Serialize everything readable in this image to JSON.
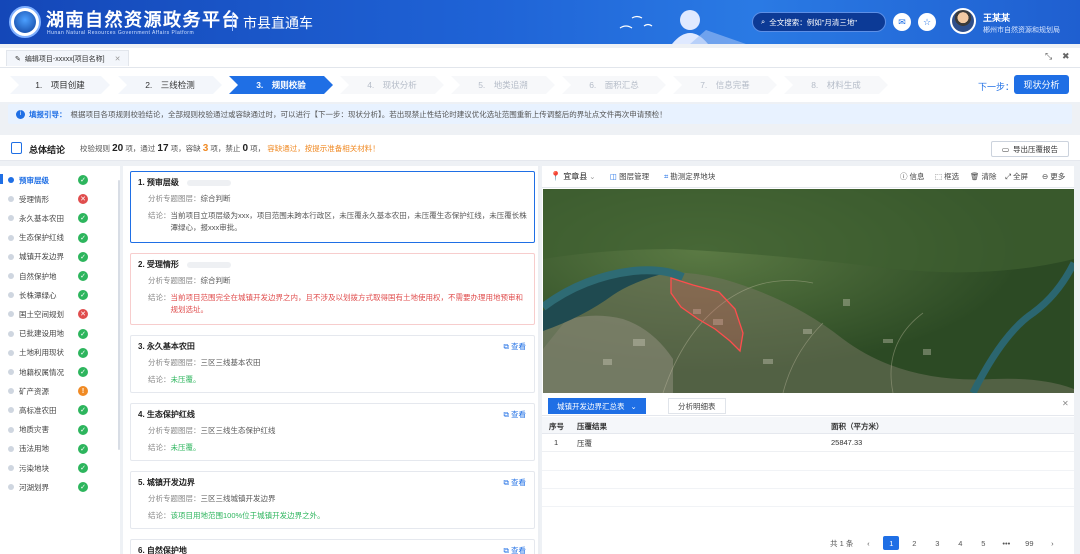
{
  "header": {
    "title": "湖南自然资源政务平台",
    "subtitle": "Hunan Natural Resources Government Affairs Platform",
    "system": "市县直通车",
    "search_placeholder": "全文搜索：例如\"月清三地\"",
    "user_name": "王某某",
    "user_dept": "郴州市自然资源和规划局"
  },
  "tabs": [
    {
      "label": "编辑项目-xxxxx[项目名称]"
    }
  ],
  "steps": [
    {
      "label": "1.　项目创建",
      "state": "done"
    },
    {
      "label": "2.　三线检测",
      "state": "done"
    },
    {
      "label": "3.　规则校验",
      "state": "active"
    },
    {
      "label": "4.　现状分析",
      "state": "todo"
    },
    {
      "label": "5.　地类追溯",
      "state": "todo"
    },
    {
      "label": "6.　面积汇总",
      "state": "todo"
    },
    {
      "label": "7.　信息完善",
      "state": "todo"
    },
    {
      "label": "8.　材料生成",
      "state": "todo"
    }
  ],
  "next": {
    "label": "下一步：",
    "button": "现状分析"
  },
  "guide": {
    "prefix": "填报引导：",
    "text": "根据项目各项规则校验结论，全部规则校验通过或容缺通过时，可以进行【下一步：现状分析】。若出现禁止性结论时建议优化选址范围重新上传调整后的界址点文件再次申请预检！"
  },
  "summary": {
    "title": "总体结论",
    "rules_label": "校验规则",
    "rules_count": "20",
    "pass_label": "项，通过",
    "pass_count": "17",
    "tol_label": "项，容缺",
    "tol_count": "3",
    "forbid_label": "项，禁止",
    "forbid_count": "0",
    "end_label": "项，",
    "notice": "容缺通过，按提示准备相关材料！",
    "export": "导出压覆报告"
  },
  "sidebar": [
    {
      "label": "预审层级",
      "status": "ok",
      "selected": true
    },
    {
      "label": "受理情形",
      "status": "err"
    },
    {
      "label": "永久基本农田",
      "status": "ok"
    },
    {
      "label": "生态保护红线",
      "status": "ok"
    },
    {
      "label": "城镇开发边界",
      "status": "ok"
    },
    {
      "label": "自然保护地",
      "status": "ok"
    },
    {
      "label": "长株潭绿心",
      "status": "ok"
    },
    {
      "label": "国土空间规划",
      "status": "err"
    },
    {
      "label": "已批建设用地",
      "status": "ok"
    },
    {
      "label": "土地利用现状",
      "status": "ok"
    },
    {
      "label": "地籍权属情况",
      "status": "ok"
    },
    {
      "label": "矿产资源",
      "status": "warn"
    },
    {
      "label": "高标准农田",
      "status": "ok"
    },
    {
      "label": "地质灾害",
      "status": "ok"
    },
    {
      "label": "违法用地",
      "status": "ok"
    },
    {
      "label": "污染地块",
      "status": "ok"
    },
    {
      "label": "河湖划界",
      "status": "ok"
    }
  ],
  "cards": [
    {
      "title": "1. 预审层级",
      "layer_label": "分析专题图层：",
      "layer": "综合判断",
      "result_label": "结论：",
      "result": "当前项目立项层级为xxx，项目范围未跨本行政区，未压覆永久基本农田，未压覆生态保护红线，未压覆长株潭绿心，报xxx审批。",
      "tone": "normal",
      "view": ""
    },
    {
      "title": "2. 受理情形",
      "layer_label": "分析专题图层：",
      "layer": "综合判断",
      "result_label": "结论：",
      "result": "当前项目范围完全在城镇开发边界之内，且不涉及以划拨方式取得国有土地使用权，不需要办理用地预审和规划选址。",
      "tone": "red",
      "view": ""
    },
    {
      "title": "3. 永久基本农田",
      "layer_label": "分析专题图层：",
      "layer": "三区三线基本农田",
      "result_label": "结论：",
      "result": "未压覆。",
      "tone": "green",
      "view": "查看"
    },
    {
      "title": "4. 生态保护红线",
      "layer_label": "分析专题图层：",
      "layer": "三区三线生态保护红线",
      "result_label": "结论：",
      "result": "未压覆。",
      "tone": "green",
      "view": "查看"
    },
    {
      "title": "5. 城镇开发边界",
      "layer_label": "分析专题图层：",
      "layer": "三区三线城镇开发边界",
      "result_label": "结论：",
      "result": "该项目用地范围100%位于城镇开发边界之外。",
      "tone": "green",
      "view": "查看"
    },
    {
      "title": "6. 自然保护地",
      "layer_label": "",
      "layer": "",
      "result_label": "",
      "result": "",
      "tone": "normal",
      "view": "查看"
    }
  ],
  "map_toolbar": {
    "county": "宜章县",
    "layer_mgmt": "图层管理",
    "draw_boundary": "勘测定界地块",
    "info": "信息",
    "select": "框选",
    "clear": "清除",
    "fullscreen": "全屏",
    "more": "更多"
  },
  "result_tabs": [
    {
      "label": "城镇开发边界汇总表"
    },
    {
      "label": "分析明细表"
    }
  ],
  "table": {
    "headers": [
      "序号",
      "压覆结果",
      "面积（平方米）"
    ],
    "rows": [
      [
        "1",
        "压覆",
        "25847.33"
      ]
    ]
  },
  "pager": {
    "total": "共 1 条",
    "pages": [
      "1",
      "2",
      "3",
      "4",
      "5",
      "•••",
      "99"
    ],
    "current": "1"
  },
  "colors": {
    "primary": "#1f6fe5",
    "ok": "#2db55d",
    "err": "#e04d4d",
    "warn": "#f08a24"
  }
}
